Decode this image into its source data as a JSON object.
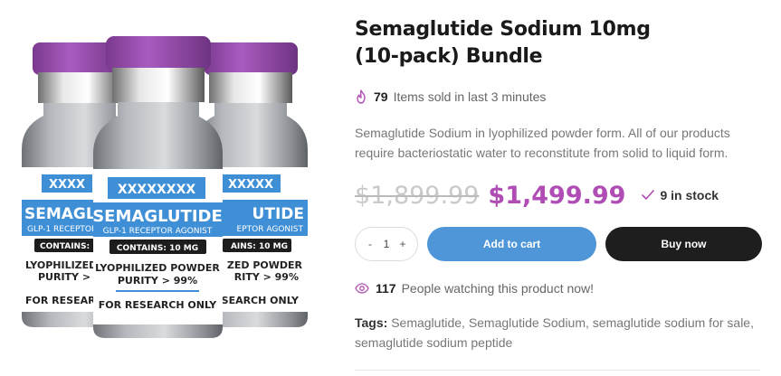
{
  "product": {
    "title": "Semaglutide Sodium 10mg (10-pack) Bundle",
    "sold_count": "79",
    "sold_text": "Items sold in last 3 minutes",
    "description": "Semaglutide Sodium in lyophilized powder form. All of our products require bacteriostatic water to reconstitute from solid to liquid form.",
    "old_price": "$1,899.99",
    "new_price": "$1,499.99",
    "stock_text": "9 in stock",
    "quantity": "1",
    "qty_minus": "-",
    "qty_plus": "+",
    "add_to_cart_label": "Add to cart",
    "buy_now_label": "Buy now",
    "watching_count": "117",
    "watching_text": "People watching this product now!",
    "tags_label": "Tags:",
    "tags": [
      "Semaglutide",
      "Semaglutide Sodium",
      "semaglutide sodium for sale",
      "semaglutide sodium peptide"
    ],
    "tag_separator": ","
  },
  "vial_labels": {
    "back_left_code": "XXXX",
    "front_code": "XXXXXXXX",
    "back_right_code": "XXXXX",
    "name": "SEMAGLUTIDE",
    "name_left_partial": "SEMAGLU",
    "name_right_partial": "UTIDE",
    "subtitle": "GLP-1 RECEPTOR AGONIST",
    "subtitle_left_partial": "GLP-1 RECEPTOR",
    "subtitle_right_partial": "EPTOR AGONIST",
    "contains": "CONTAINS: 10 MG",
    "contains_left_partial": "CONTAINS:",
    "contains_right_partial": "AINS: 10 MG",
    "powder": "LYOPHILIZED POWDER",
    "powder_left_partial": "LYOPHILIZED",
    "powder_right_partial": "ZED POWDER",
    "purity": "PURITY > 99%",
    "purity_left_partial": "PURITY >",
    "purity_right_partial": "RITY > 99%",
    "research": "FOR RESEARCH ONLY",
    "research_left_partial": "FOR RESEARCH",
    "research_right_partial": "SEARCH ONLY"
  },
  "colors": {
    "cap": "#9b4fb0",
    "label_blue": "#3f8fd6",
    "price_accent": "#b04db5",
    "add_to_cart_bg": "#4f96d8",
    "buy_now_bg": "#1e1e1e"
  },
  "icons": {
    "sold": "flame-icon",
    "stock": "check-icon",
    "watching": "eye-icon"
  }
}
